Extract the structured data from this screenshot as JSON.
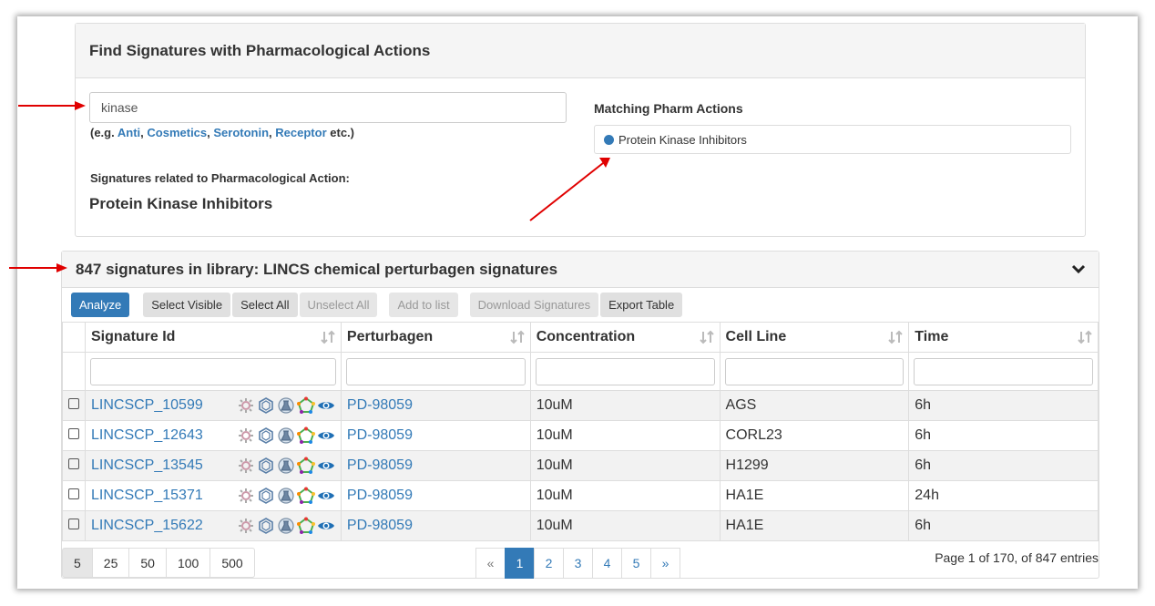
{
  "find_panel": {
    "title": "Find Signatures with Pharmacological Actions",
    "search_value": "kinase",
    "examples_prefix": "(e.g.",
    "examples": [
      "Anti",
      "Cosmetics",
      "Serotonin",
      "Receptor"
    ],
    "examples_suffix": "etc.)",
    "related_label": "Signatures related to Pharmacological Action:",
    "related_value": "Protein Kinase Inhibitors",
    "matching_label": "Matching Pharm Actions",
    "matching_items": [
      "Protein Kinase Inhibitors"
    ]
  },
  "library_panel": {
    "title": "847 signatures in library: LINCS chemical perturbagen signatures",
    "buttons": {
      "analyze": "Analyze",
      "select_visible": "Select Visible",
      "select_all": "Select All",
      "unselect_all": "Unselect All",
      "add_to_list": "Add to list",
      "download": "Download Signatures",
      "export": "Export Table"
    },
    "columns": [
      "Signature Id",
      "Perturbagen",
      "Concentration",
      "Cell Line",
      "Time"
    ],
    "rows": [
      {
        "id": "LINCSCP_10599",
        "perturbagen": "PD-98059",
        "concentration": "10uM",
        "cell_line": "AGS",
        "time": "6h"
      },
      {
        "id": "LINCSCP_12643",
        "perturbagen": "PD-98059",
        "concentration": "10uM",
        "cell_line": "CORL23",
        "time": "6h"
      },
      {
        "id": "LINCSCP_13545",
        "perturbagen": "PD-98059",
        "concentration": "10uM",
        "cell_line": "H1299",
        "time": "6h"
      },
      {
        "id": "LINCSCP_15371",
        "perturbagen": "PD-98059",
        "concentration": "10uM",
        "cell_line": "HA1E",
        "time": "24h"
      },
      {
        "id": "LINCSCP_15622",
        "perturbagen": "PD-98059",
        "concentration": "10uM",
        "cell_line": "HA1E",
        "time": "6h"
      }
    ],
    "row_icons": [
      "gear-icon",
      "hexagon-icon",
      "flask-icon",
      "pentagon-icon",
      "eye-icon"
    ],
    "page_sizes": [
      "5",
      "25",
      "50",
      "100",
      "500"
    ],
    "active_page_size": "5",
    "pages": [
      "«",
      "1",
      "2",
      "3",
      "4",
      "5",
      "»"
    ],
    "active_page": "1",
    "page_info": "Page 1 of 170, of 847 entries"
  },
  "colors": {
    "link": "#337ab7",
    "annotation_arrow": "#e00000"
  }
}
